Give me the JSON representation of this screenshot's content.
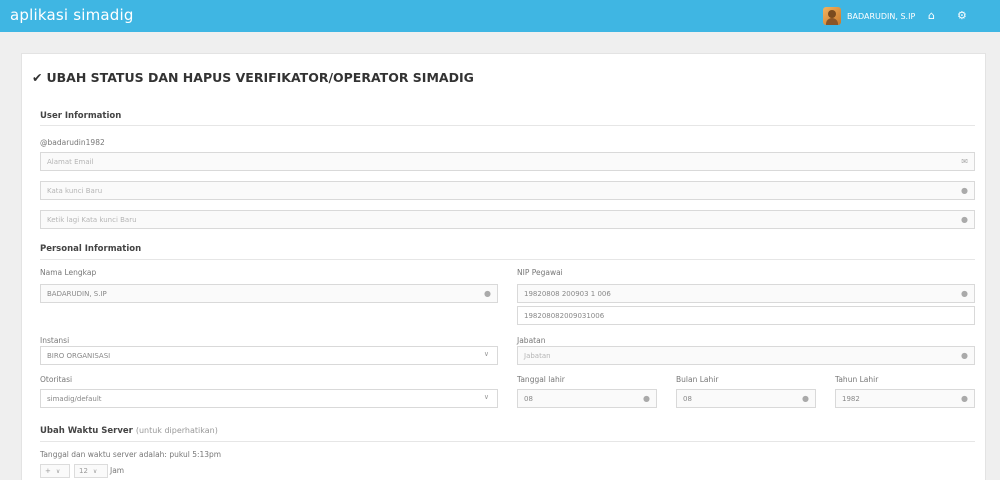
{
  "app": {
    "brand": "aplikasi simadig",
    "user_name": "BADARUDIN, S.IP"
  },
  "page": {
    "title": "UBAH STATUS DAN HAPUS VERIFIKATOR/OPERATOR SIMADIG"
  },
  "user_info": {
    "heading": "User Information",
    "username": "@badarudin1982",
    "email_placeholder": "Alamat Email",
    "password_placeholder": "Kata kunci Baru",
    "password_confirm_placeholder": "Ketik lagi Kata kunci Baru"
  },
  "personal_info": {
    "heading": "Personal Information",
    "nama_label": "Nama Lengkap",
    "nama_value": "BADARUDIN, S.IP",
    "nip_label": "NIP Pegawai",
    "nip_value": "19820808 200903 1 006",
    "nip_raw_value": "198208082009031006",
    "instansi_label": "Instansi",
    "instansi_value": "BIRO ORGANISASI",
    "jabatan_label": "Jabatan",
    "jabatan_placeholder": "Jabatan",
    "otoritas_label": "Otoritasi",
    "otoritas_value": "simadig/default",
    "tanggal_label": "Tanggal lahir",
    "tanggal_value": "08",
    "bulan_label": "Bulan Lahir",
    "bulan_value": "08",
    "tahun_label": "Tahun Lahir",
    "tahun_value": "1982"
  },
  "server_time": {
    "heading": "Ubah Waktu Server",
    "heading_note": "(untuk diperhatikan)",
    "description": "Tanggal dan waktu server adalah: pukul 5:13pm",
    "select_1": "+",
    "select_2": "12",
    "unit": "Jam"
  },
  "icons": {
    "email": "envelope-icon",
    "password": "lock-icon",
    "user": "user-icon",
    "home": "home-icon",
    "tools": "wrench-icon"
  }
}
